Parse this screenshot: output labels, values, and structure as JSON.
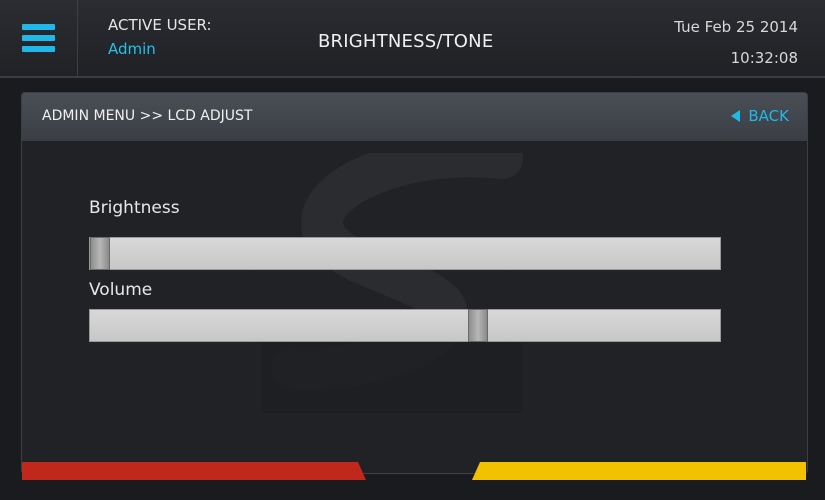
{
  "header": {
    "active_user_label": "ACTIVE USER:",
    "active_user_value": "Admin",
    "title": "BRIGHTNESS/TONE",
    "date": "Tue Feb 25 2014",
    "time": "10:32:08"
  },
  "panel": {
    "breadcrumb": "ADMIN MENU >> LCD ADJUST",
    "back_label": "BACK"
  },
  "sliders": [
    {
      "label": "Brightness",
      "value_percent": 0
    },
    {
      "label": "Volume",
      "value_percent": 62
    }
  ],
  "icons": {
    "menu": "hamburger-menu-icon",
    "back": "triangle-left-icon",
    "watermark": "logo-watermark"
  },
  "colors": {
    "accent": "#22b8e8",
    "bar_red": "#c0281c",
    "bar_yellow": "#f2c200"
  }
}
